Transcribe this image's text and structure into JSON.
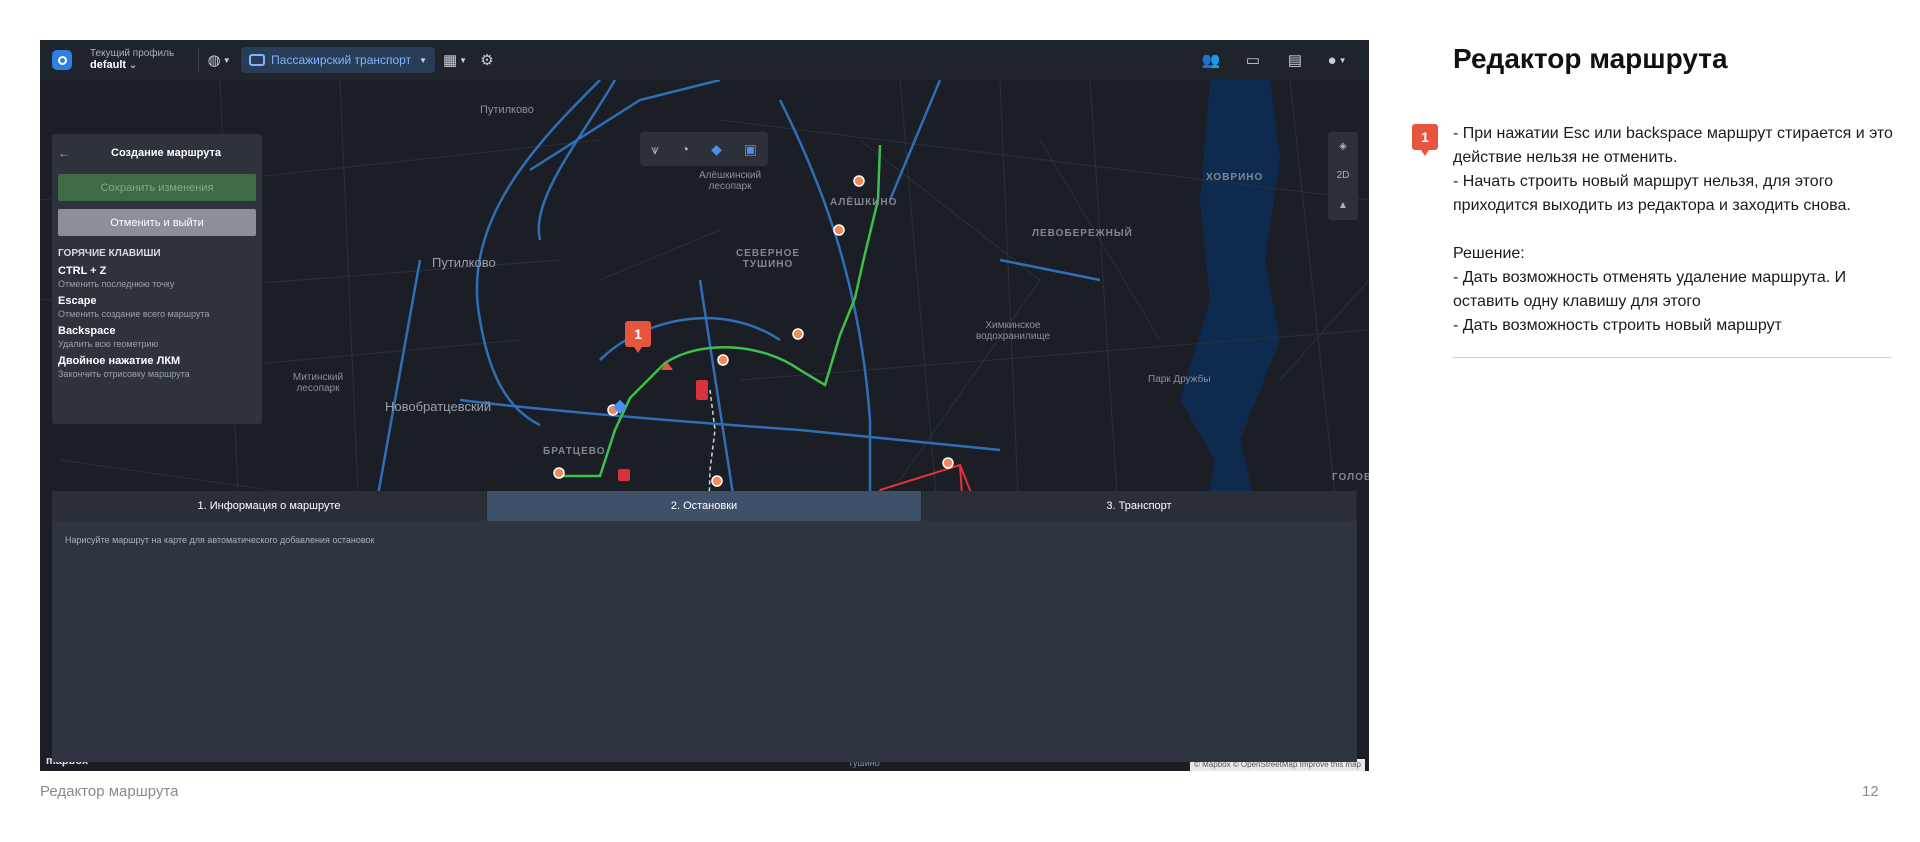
{
  "app": {
    "profile_label": "Текущий профиль",
    "profile_value": "default",
    "mode_label": "Пассажирский транспорт",
    "icons": [
      "globe-icon",
      "bus-icon",
      "dashboard-icon",
      "car-settings-icon",
      "users-icon",
      "archive-icon",
      "clipboard-icon",
      "user-icon"
    ]
  },
  "map": {
    "labels": [
      "Путилково",
      "Путилково",
      "Алёшкинский лесопарк",
      "АЛЁШКИНО",
      "СЕВЕРНОЕ ТУШИНО",
      "ХОВРИНО",
      "ЛЕВОБЕРЕЖНЫЙ",
      "Химкинское водохранилище",
      "Парк Дружбы",
      "Митинский лесопарк",
      "Новобратцевский",
      "БРАТЦЕВО",
      "ГОЛОВ",
      "Тушино"
    ],
    "side_2d": "2D",
    "attribution": "© Mapbox © OpenStreetMap  Improve this map",
    "mapbox": "mapbox"
  },
  "editor": {
    "title": "Создание маршрута",
    "save_label": "Сохранить изменения",
    "cancel_label": "Отменить и выйти",
    "hotkeys_heading": "ГОРЯЧИЕ КЛАВИШИ",
    "hotkeys": [
      {
        "key": "CTRL + Z",
        "desc": "Отменить последнюю точку"
      },
      {
        "key": "Escape",
        "desc": "Отменить создание всего маршрута"
      },
      {
        "key": "Backspace",
        "desc": "Удалить всю геометрию"
      },
      {
        "key": "Двойное нажатие ЛКМ",
        "desc": "Закончить отрисовку маршрута"
      }
    ]
  },
  "bottom": {
    "tabs": [
      "1. Информация о маршруте",
      "2. Остановки",
      "3. Транспорт"
    ],
    "active_tab": 1,
    "hint": "Нарисуйте маршрут на карте для автоматического добавления остановок"
  },
  "marker_number": "1",
  "notes": {
    "title": "Редактор маршрута",
    "marker_number": "1",
    "lines1": [
      "- При нажатии Esc или backspace маршрут стирается и это действие нельзя не отменить.",
      "- Начать строить новый маршрут нельзя, для этого приходится выходить из редактора и заходить снова."
    ],
    "solution_heading": "Решение:",
    "lines2": [
      "- Дать возможность отменять удаление маршрута. И оставить одну клавишу для этого",
      "- Дать возможность строить новый маршрут"
    ]
  },
  "footer": {
    "left": "Редактор маршрута",
    "page": "12"
  },
  "colors": {
    "accent": "#e8553f",
    "route_green": "#3ec14c",
    "route_red": "#e0323c",
    "road_blue": "#2f6fb8"
  }
}
